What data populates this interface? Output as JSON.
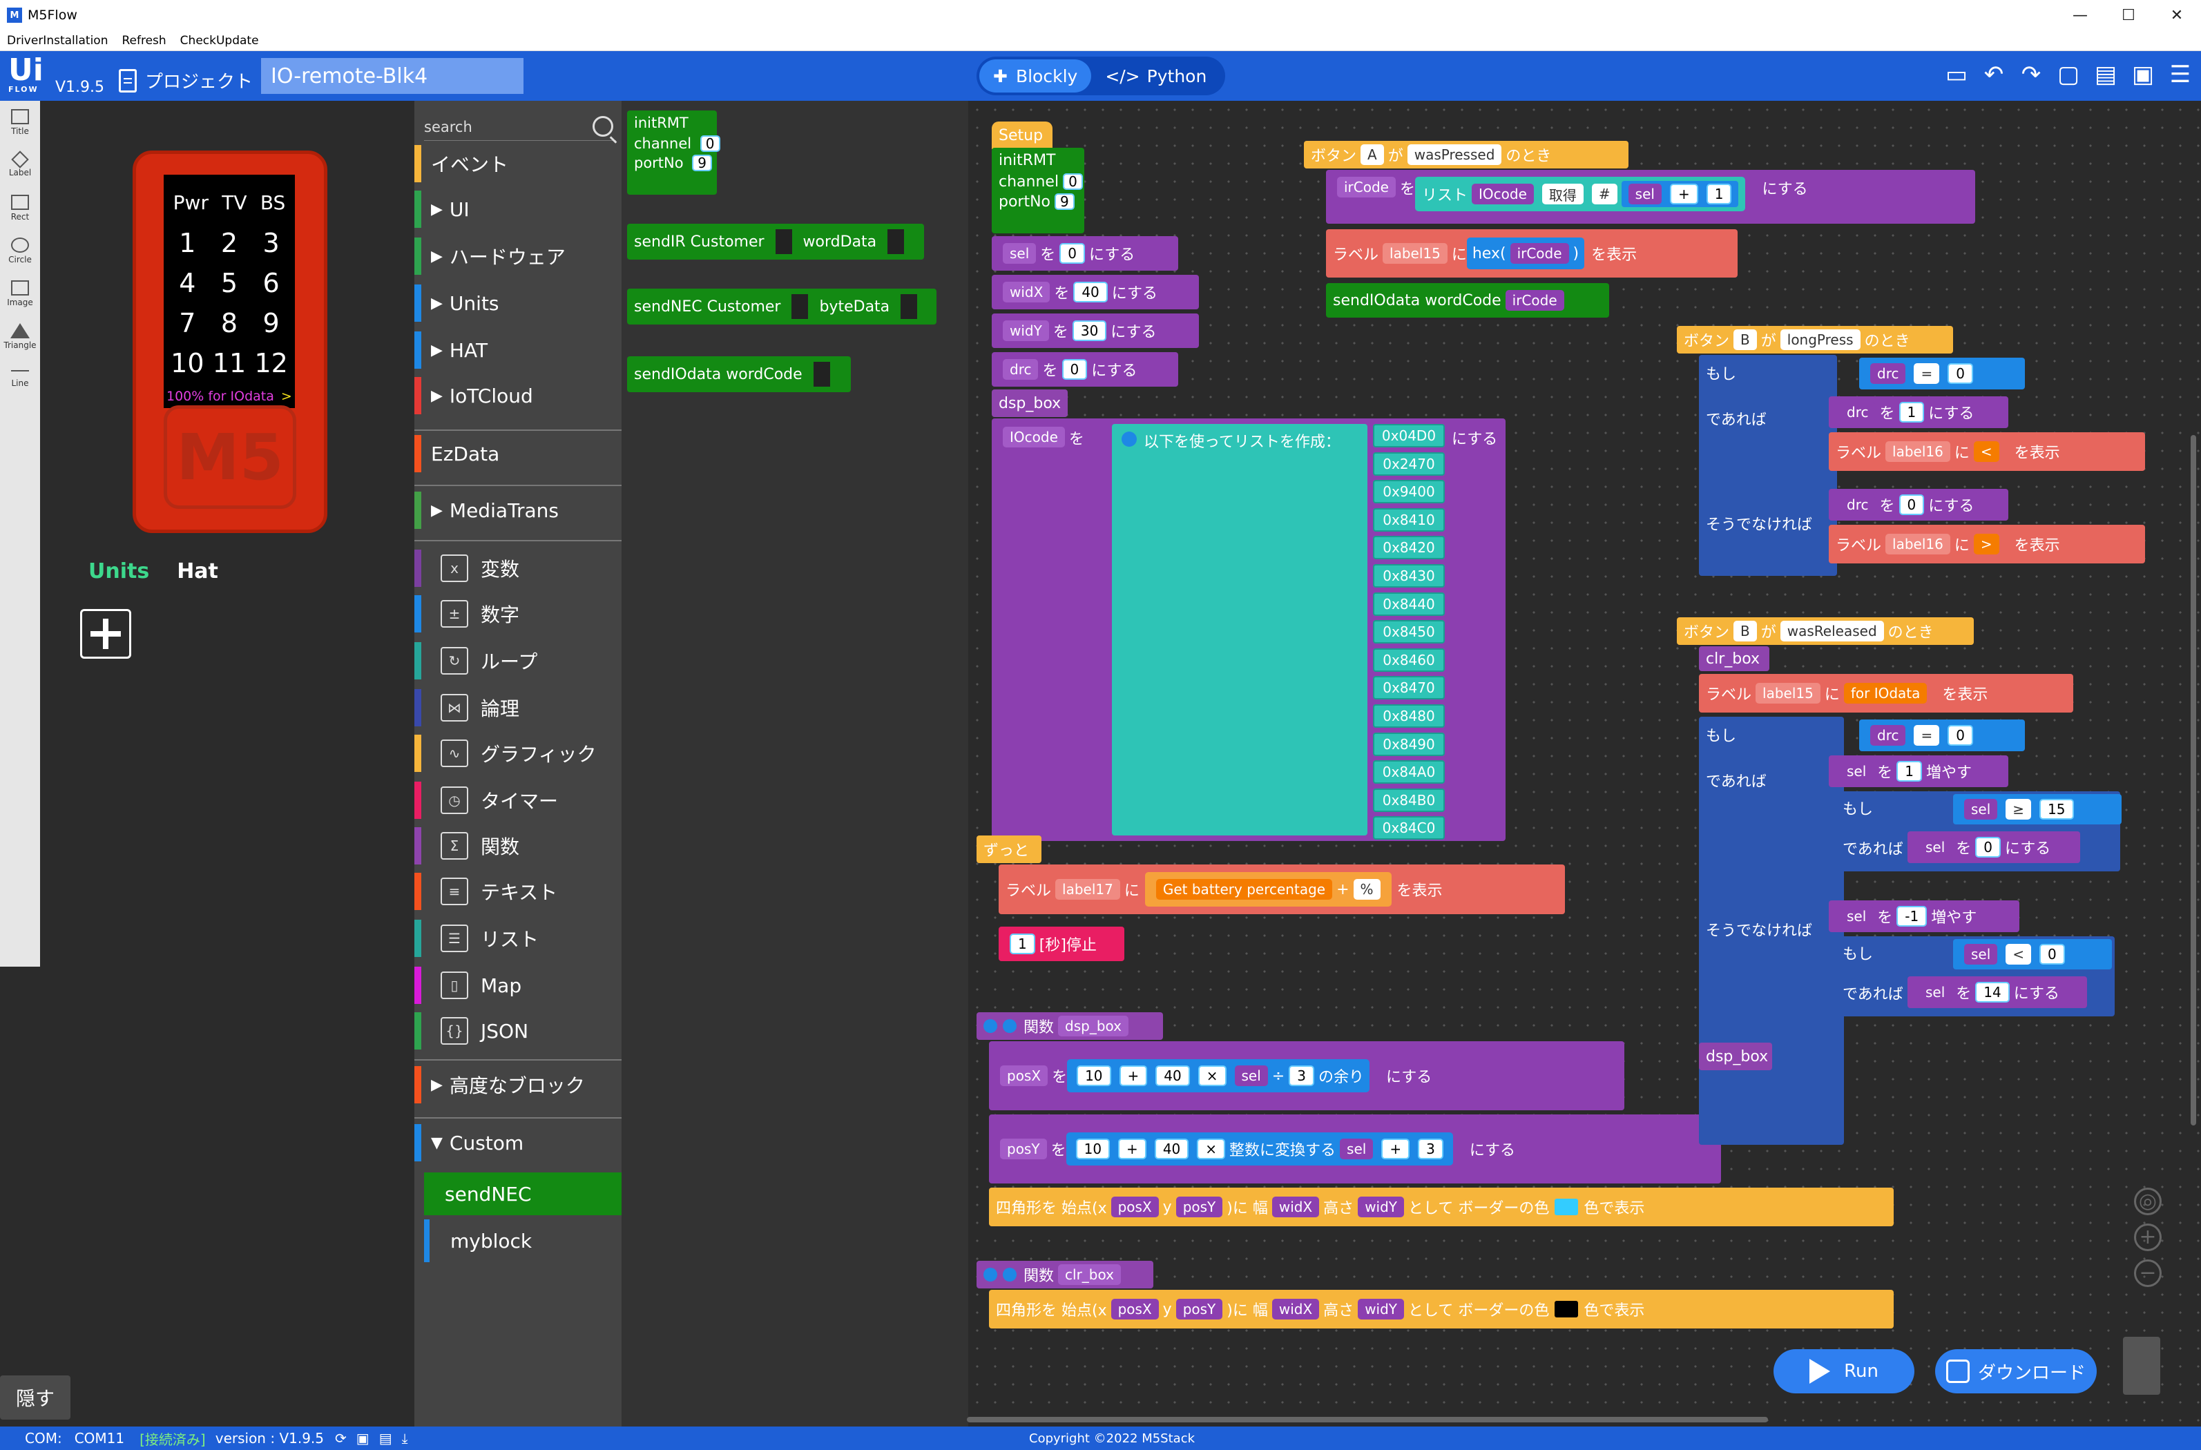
{
  "window": {
    "app_name": "M5Flow",
    "min": "—",
    "max": "☐",
    "close": "✕"
  },
  "menubar": [
    "DriverInstallation",
    "Refresh",
    "CheckUpdate"
  ],
  "header": {
    "logo": "Ui",
    "logo_sub": "FLOW",
    "version": "V1.9.5",
    "project_label": "プロジェクト",
    "project_name": "IO-remote-Blk4",
    "mode_blockly": "Blockly",
    "mode_python": "Python"
  },
  "leftstrip": [
    "Title",
    "Label",
    "Rect",
    "Circle",
    "Image",
    "Triangle",
    "Line"
  ],
  "device": {
    "header_row": [
      "Pwr",
      "TV",
      "BS"
    ],
    "rows": [
      [
        "1",
        "2",
        "3"
      ],
      [
        "4",
        "5",
        "6"
      ],
      [
        "7",
        "8",
        "9"
      ],
      [
        "10",
        "11",
        "12"
      ]
    ],
    "battery": "100% for IOdata",
    "arrow": ">",
    "logo": "M5"
  },
  "units_tabs": {
    "units": "Units",
    "hat": "Hat"
  },
  "hide_label": "隠す",
  "search_placeholder": "search",
  "categories": [
    {
      "label": "イベント",
      "color": "#f6b53b",
      "arrow": "",
      "icon": ""
    },
    {
      "label": "UI",
      "color": "#2ea44f",
      "arrow": "▶",
      "icon": ""
    },
    {
      "label": "ハードウェア",
      "color": "#2ea44f",
      "arrow": "▶",
      "icon": ""
    },
    {
      "label": "Units",
      "color": "#1e88e5",
      "arrow": "▶",
      "icon": ""
    },
    {
      "label": "HAT",
      "color": "#1e88e5",
      "arrow": "▶",
      "icon": ""
    },
    {
      "label": "IoTCloud",
      "color": "#e53935",
      "arrow": "▶",
      "icon": ""
    },
    {
      "label": "EzData",
      "color": "#f4511e",
      "arrow": "",
      "icon": ""
    },
    {
      "label": "MediaTrans",
      "color": "#43a047",
      "arrow": "▶",
      "icon": ""
    },
    {
      "label": "変数",
      "color": "#7b3fa0",
      "arrow": "",
      "icon": "x"
    },
    {
      "label": "数字",
      "color": "#1e88e5",
      "arrow": "",
      "icon": "±"
    },
    {
      "label": "ループ",
      "color": "#26a69a",
      "arrow": "",
      "icon": "↻"
    },
    {
      "label": "論理",
      "color": "#3949ab",
      "arrow": "",
      "icon": "⋈"
    },
    {
      "label": "グラフィック",
      "color": "#f6b53b",
      "arrow": "",
      "icon": "∿"
    },
    {
      "label": "タイマー",
      "color": "#e91e63",
      "arrow": "",
      "icon": "◷"
    },
    {
      "label": "関数",
      "color": "#8e44ad",
      "arrow": "",
      "icon": "Σ"
    },
    {
      "label": "テキスト",
      "color": "#f4511e",
      "arrow": "",
      "icon": "≡"
    },
    {
      "label": "リスト",
      "color": "#26a69a",
      "arrow": "",
      "icon": "☰"
    },
    {
      "label": "Map",
      "color": "#d81bd8",
      "arrow": "",
      "icon": "▯"
    },
    {
      "label": "JSON",
      "color": "#2ea44f",
      "arrow": "",
      "icon": "{}"
    },
    {
      "label": "高度なブロック",
      "color": "#f4511e",
      "arrow": "▶",
      "icon": ""
    },
    {
      "label": "Custom",
      "color": "#1e88e5",
      "arrow": "▼",
      "icon": ""
    }
  ],
  "custom_sub": [
    "sendNEC",
    "myblock"
  ],
  "flyout": {
    "initRMT": "initRMT",
    "channel": "channel",
    "channel_val": "0",
    "portNo": "portNo",
    "portNo_val": "9",
    "sendIR": "sendIR  Customer",
    "wordData": "wordData",
    "sendNEC": "sendNEC  Customer",
    "byteData": "byteData",
    "sendIOdata": "sendIOdata  wordCode"
  },
  "blocks": {
    "setup": "Setup",
    "init": "initRMT",
    "channel": "channel",
    "channel_val": "0",
    "portNo": "portNo",
    "portNo_val": "9",
    "sel": "sel",
    "widX": "widX",
    "widY": "widY",
    "drc": "drc",
    "wo": "を",
    "nisuru": "にする",
    "v0": "0",
    "v40": "40",
    "v30": "30",
    "v0b": "0",
    "dsp_box": "dsp_box",
    "iocode": "IOcode",
    "make_list": "以下を使ってリストを作成：",
    "list": [
      "0x04D0",
      "0x2470",
      "0x9400",
      "0x8410",
      "0x8420",
      "0x8430",
      "0x8440",
      "0x8450",
      "0x8460",
      "0x8470",
      "0x8480",
      "0x8490",
      "0x84A0",
      "0x84B0",
      "0x84C0"
    ],
    "forever": "ずっと",
    "label": "ラベル",
    "label17": "label17",
    "ni": "に",
    "battery": "Get battery percentage",
    "plus": "+",
    "percent": "%",
    "hyouji": "を表示",
    "wait": "[秒]停止",
    "one": "1",
    "func": "関数",
    "func_dsp": "dsp_box",
    "posX": "posX",
    "posY": "posY",
    "ten": "10",
    "forty": "40",
    "three": "3",
    "mod": "の余り",
    "mul": "×",
    "div": "÷",
    "toint": "整数に変換する",
    "rect": "四角形を 始点(x",
    "y": "y",
    ")に": ")に 幅",
    "height": "高さ",
    "border": "として ボーダーの色",
    "show_color": "色で表示",
    "func_clr": "clr_box",
    "btnA": "ボタン",
    "A": "A",
    "ga": "が",
    "wasPressed": "wasPressed",
    "notoki": "のとき",
    "irCode": "irCode",
    "risuto": "リスト",
    "get": "取得",
    "hash": "#",
    "hex": "hex(",
    "hexclose": ")",
    "label15": "label15",
    "sendIO": "sendIOdata  wordCode",
    "btnB": "B",
    "longPress": "longPress",
    "if": "もし",
    "then": "であれば",
    "else": "そうでなければ",
    "eq": "=",
    "label16": "label16",
    "lt": "<",
    "gt": ">",
    "wasReleased": "wasReleased",
    "clr_box": "clr_box",
    "for_iodata": "for IOdata",
    "inc": "増やす",
    "ge": "≥",
    "fifteen": "15",
    "minus1": "-1",
    "fourteen": "14"
  },
  "run": "Run",
  "download": "ダウンロード",
  "status": {
    "com": "COM:",
    "port": "COM11",
    "connected": "[接続済み]",
    "version": "version : V1.9.5",
    "copyright": "Copyright ©2022 M5Stack"
  }
}
